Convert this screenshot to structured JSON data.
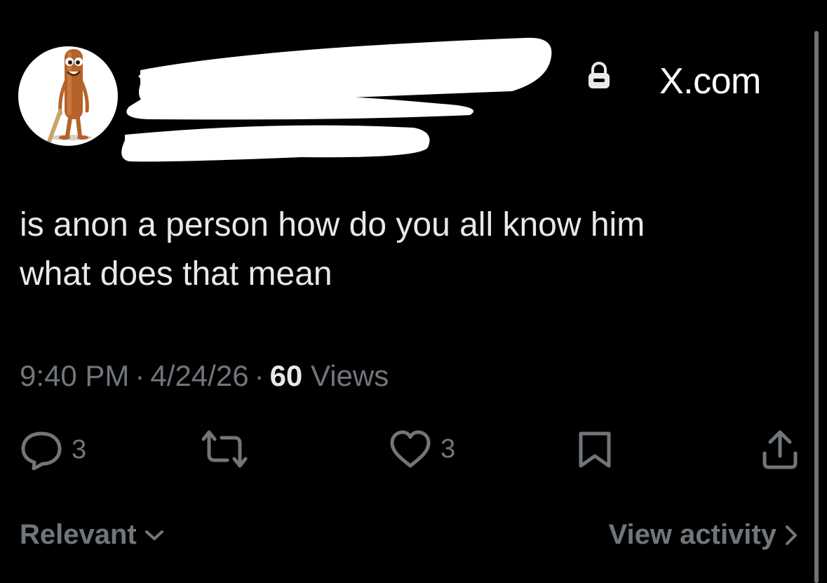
{
  "header": {
    "site_label": "X.com",
    "avatar_icon": "character-avatar",
    "lock_icon": "lock-icon"
  },
  "tweet": {
    "text_line_1": "is anon a person how do you all know him",
    "text_line_2": "what does that mean",
    "time": "9:40 PM",
    "date": "4/24/26",
    "views_count": "60",
    "views_label": "Views",
    "separator": "·"
  },
  "actions": {
    "reply_count": "3",
    "like_count": "3"
  },
  "footer": {
    "sort_label": "Relevant",
    "activity_label": "View activity"
  },
  "colors": {
    "background": "#000000",
    "text": "#e7e9ea",
    "muted": "#71767b"
  }
}
